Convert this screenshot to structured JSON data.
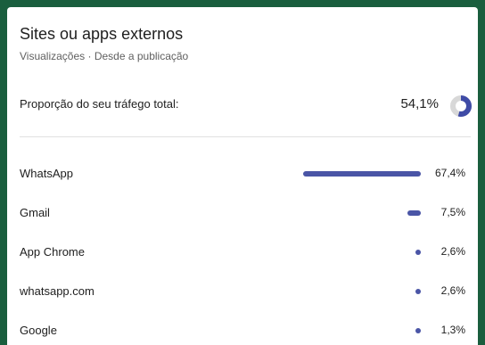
{
  "panel": {
    "title": "Sites ou apps externos",
    "subtitle": "Visualizações · Desde a publicação"
  },
  "total": {
    "label": "Proporção do seu tráfego total:",
    "value": "54,1%",
    "fraction": 0.541,
    "accent_color": "#3f4ba6",
    "track_color": "#d8d8d8"
  },
  "rows": [
    {
      "label": "WhatsApp",
      "value": "67,4%",
      "fraction": 0.674
    },
    {
      "label": "Gmail",
      "value": "7,5%",
      "fraction": 0.075
    },
    {
      "label": "App Chrome",
      "value": "2,6%",
      "fraction": 0.026
    },
    {
      "label": "whatsapp.com",
      "value": "2,6%",
      "fraction": 0.026
    },
    {
      "label": "Google",
      "value": "1,3%",
      "fraction": 0.013
    }
  ],
  "colors": {
    "bar": "#4a55a6",
    "background": "#1a5e3e"
  }
}
